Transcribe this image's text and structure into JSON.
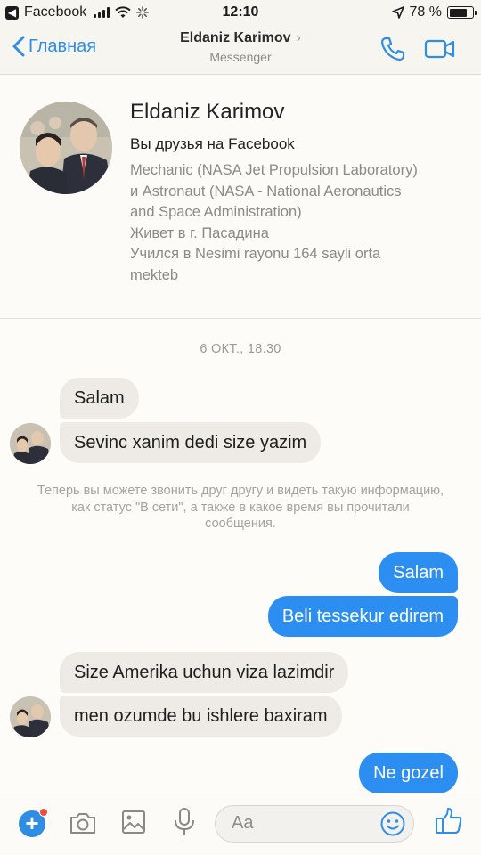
{
  "status_bar": {
    "back_app_glyph": "◀",
    "app_name": "Facebook",
    "time": "12:10",
    "battery_text": "78 %",
    "battery_level": 0.78,
    "icons": [
      "signal-icon",
      "wifi-icon",
      "loading-icon",
      "location-icon",
      "battery-icon"
    ]
  },
  "header": {
    "back_label": "Главная",
    "title": "Eldaniz Karimov",
    "title_chevron": "›",
    "subtitle": "Messenger",
    "accent_color": "#2f8de4"
  },
  "profile": {
    "name": "Eldaniz Karimov",
    "friends_text": "Вы друзья на Facebook",
    "details": [
      "Mechanic (NASA Jet Propulsion Laboratory)\nи Astronaut (NASA - National Aeronautics\nand Space Administration)",
      "Живет в г. Пасадина",
      "Учился в Nesimi rayonu 164 sayli orta\nmekteb"
    ]
  },
  "conversation": {
    "timestamp": "6 ОКТ., 18:30",
    "messages": [
      {
        "direction": "in",
        "text": "Salam"
      },
      {
        "direction": "in",
        "text": "Sevinc xanim dedi size yazim"
      },
      {
        "direction": "out",
        "text": "Salam"
      },
      {
        "direction": "out",
        "text": "Beli tessekur edirem"
      },
      {
        "direction": "in",
        "text": "Size Amerika uchun viza lazimdir"
      },
      {
        "direction": "in",
        "text": "men ozumde bu ishlere baxiram"
      },
      {
        "direction": "out",
        "text": "Ne gozel"
      }
    ],
    "system_note": "Теперь вы можете звонить друг другу и видеть такую информацию, как статус \"В сети\", а также в какое время вы прочитали сообщения."
  },
  "composer": {
    "plus_glyph": "+",
    "placeholder": "Aa",
    "icons": [
      "plus-icon",
      "camera-icon",
      "image-icon",
      "microphone-icon",
      "emoji-icon",
      "thumbs-up-icon"
    ]
  },
  "colors": {
    "outgoing_bubble": "#2b8ef0",
    "incoming_bubble": "#eeebe6",
    "notification_dot": "#f04a3a"
  }
}
